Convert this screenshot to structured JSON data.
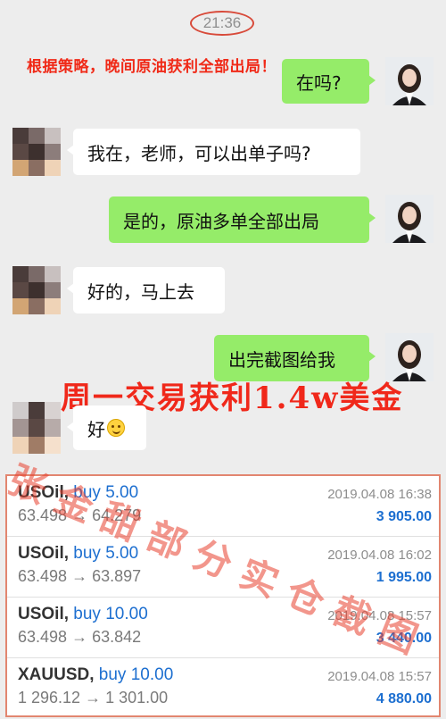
{
  "time": "21:36",
  "annotation_top": "根据策略，晚间原油获利全部出局！",
  "messages": [
    {
      "side": "out",
      "text": "在吗?"
    },
    {
      "side": "in",
      "text": "我在，老师，可以出单子吗?"
    },
    {
      "side": "out",
      "text": "是的，原油多单全部出局"
    },
    {
      "side": "in",
      "text": "好的，马上去"
    },
    {
      "side": "out",
      "text": "出完截图给我"
    },
    {
      "side": "in",
      "text": "好"
    }
  ],
  "annotation_profit": "周一交易获利1.4w美金",
  "trades": [
    {
      "symbol": "USOil,",
      "action": "buy 5.00",
      "open": "63.498",
      "close": "64.279",
      "date": "2019.04.08 16:38",
      "profit": "3 905.00"
    },
    {
      "symbol": "USOil,",
      "action": "buy 5.00",
      "open": "63.498",
      "close": "63.897",
      "date": "2019.04.08 16:02",
      "profit": "1 995.00"
    },
    {
      "symbol": "USOil,",
      "action": "buy 10.00",
      "open": "63.498",
      "close": "63.842",
      "date": "2019.04.08 15:57",
      "profit": "3 440.00"
    },
    {
      "symbol": "XAUUSD,",
      "action": "buy 10.00",
      "open": "1 296.12",
      "close": "1 301.00",
      "date": "2019.04.08 15:57",
      "profit": "4 880.00"
    }
  ],
  "arrow": "→",
  "watermark": "张金甜部分实仓截图",
  "colors": {
    "outgoing_bubble": "#95ec69",
    "annotation_red": "#f02a18",
    "buy_blue": "#1d6fd0"
  }
}
